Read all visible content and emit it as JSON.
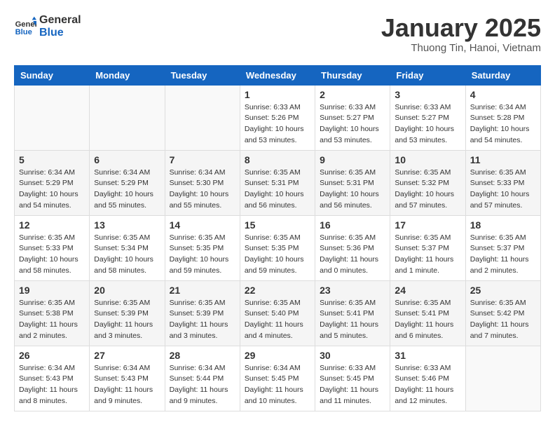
{
  "logo": {
    "line1": "General",
    "line2": "Blue"
  },
  "title": "January 2025",
  "location": "Thuong Tin, Hanoi, Vietnam",
  "weekdays": [
    "Sunday",
    "Monday",
    "Tuesday",
    "Wednesday",
    "Thursday",
    "Friday",
    "Saturday"
  ],
  "weeks": [
    [
      {
        "day": "",
        "info": ""
      },
      {
        "day": "",
        "info": ""
      },
      {
        "day": "",
        "info": ""
      },
      {
        "day": "1",
        "info": "Sunrise: 6:33 AM\nSunset: 5:26 PM\nDaylight: 10 hours\nand 53 minutes."
      },
      {
        "day": "2",
        "info": "Sunrise: 6:33 AM\nSunset: 5:27 PM\nDaylight: 10 hours\nand 53 minutes."
      },
      {
        "day": "3",
        "info": "Sunrise: 6:33 AM\nSunset: 5:27 PM\nDaylight: 10 hours\nand 53 minutes."
      },
      {
        "day": "4",
        "info": "Sunrise: 6:34 AM\nSunset: 5:28 PM\nDaylight: 10 hours\nand 54 minutes."
      }
    ],
    [
      {
        "day": "5",
        "info": "Sunrise: 6:34 AM\nSunset: 5:29 PM\nDaylight: 10 hours\nand 54 minutes."
      },
      {
        "day": "6",
        "info": "Sunrise: 6:34 AM\nSunset: 5:29 PM\nDaylight: 10 hours\nand 55 minutes."
      },
      {
        "day": "7",
        "info": "Sunrise: 6:34 AM\nSunset: 5:30 PM\nDaylight: 10 hours\nand 55 minutes."
      },
      {
        "day": "8",
        "info": "Sunrise: 6:35 AM\nSunset: 5:31 PM\nDaylight: 10 hours\nand 56 minutes."
      },
      {
        "day": "9",
        "info": "Sunrise: 6:35 AM\nSunset: 5:31 PM\nDaylight: 10 hours\nand 56 minutes."
      },
      {
        "day": "10",
        "info": "Sunrise: 6:35 AM\nSunset: 5:32 PM\nDaylight: 10 hours\nand 57 minutes."
      },
      {
        "day": "11",
        "info": "Sunrise: 6:35 AM\nSunset: 5:33 PM\nDaylight: 10 hours\nand 57 minutes."
      }
    ],
    [
      {
        "day": "12",
        "info": "Sunrise: 6:35 AM\nSunset: 5:33 PM\nDaylight: 10 hours\nand 58 minutes."
      },
      {
        "day": "13",
        "info": "Sunrise: 6:35 AM\nSunset: 5:34 PM\nDaylight: 10 hours\nand 58 minutes."
      },
      {
        "day": "14",
        "info": "Sunrise: 6:35 AM\nSunset: 5:35 PM\nDaylight: 10 hours\nand 59 minutes."
      },
      {
        "day": "15",
        "info": "Sunrise: 6:35 AM\nSunset: 5:35 PM\nDaylight: 10 hours\nand 59 minutes."
      },
      {
        "day": "16",
        "info": "Sunrise: 6:35 AM\nSunset: 5:36 PM\nDaylight: 11 hours\nand 0 minutes."
      },
      {
        "day": "17",
        "info": "Sunrise: 6:35 AM\nSunset: 5:37 PM\nDaylight: 11 hours\nand 1 minute."
      },
      {
        "day": "18",
        "info": "Sunrise: 6:35 AM\nSunset: 5:37 PM\nDaylight: 11 hours\nand 2 minutes."
      }
    ],
    [
      {
        "day": "19",
        "info": "Sunrise: 6:35 AM\nSunset: 5:38 PM\nDaylight: 11 hours\nand 2 minutes."
      },
      {
        "day": "20",
        "info": "Sunrise: 6:35 AM\nSunset: 5:39 PM\nDaylight: 11 hours\nand 3 minutes."
      },
      {
        "day": "21",
        "info": "Sunrise: 6:35 AM\nSunset: 5:39 PM\nDaylight: 11 hours\nand 3 minutes."
      },
      {
        "day": "22",
        "info": "Sunrise: 6:35 AM\nSunset: 5:40 PM\nDaylight: 11 hours\nand 4 minutes."
      },
      {
        "day": "23",
        "info": "Sunrise: 6:35 AM\nSunset: 5:41 PM\nDaylight: 11 hours\nand 5 minutes."
      },
      {
        "day": "24",
        "info": "Sunrise: 6:35 AM\nSunset: 5:41 PM\nDaylight: 11 hours\nand 6 minutes."
      },
      {
        "day": "25",
        "info": "Sunrise: 6:35 AM\nSunset: 5:42 PM\nDaylight: 11 hours\nand 7 minutes."
      }
    ],
    [
      {
        "day": "26",
        "info": "Sunrise: 6:34 AM\nSunset: 5:43 PM\nDaylight: 11 hours\nand 8 minutes."
      },
      {
        "day": "27",
        "info": "Sunrise: 6:34 AM\nSunset: 5:43 PM\nDaylight: 11 hours\nand 9 minutes."
      },
      {
        "day": "28",
        "info": "Sunrise: 6:34 AM\nSunset: 5:44 PM\nDaylight: 11 hours\nand 9 minutes."
      },
      {
        "day": "29",
        "info": "Sunrise: 6:34 AM\nSunset: 5:45 PM\nDaylight: 11 hours\nand 10 minutes."
      },
      {
        "day": "30",
        "info": "Sunrise: 6:33 AM\nSunset: 5:45 PM\nDaylight: 11 hours\nand 11 minutes."
      },
      {
        "day": "31",
        "info": "Sunrise: 6:33 AM\nSunset: 5:46 PM\nDaylight: 11 hours\nand 12 minutes."
      },
      {
        "day": "",
        "info": ""
      }
    ]
  ]
}
